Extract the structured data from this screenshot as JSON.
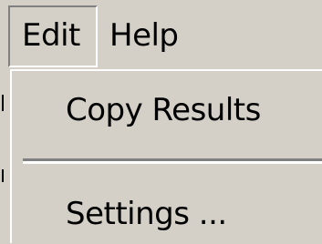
{
  "menubar": {
    "menus": [
      {
        "label": "Edit",
        "open": true
      },
      {
        "label": "Help",
        "open": false
      }
    ]
  },
  "edit_menu": {
    "items": [
      {
        "label": "Copy Results"
      },
      {
        "label": "Settings ..."
      }
    ]
  },
  "colors": {
    "face": "#d4d0c8",
    "shadow": "#808080",
    "highlight": "#ffffff",
    "text": "#000000"
  }
}
